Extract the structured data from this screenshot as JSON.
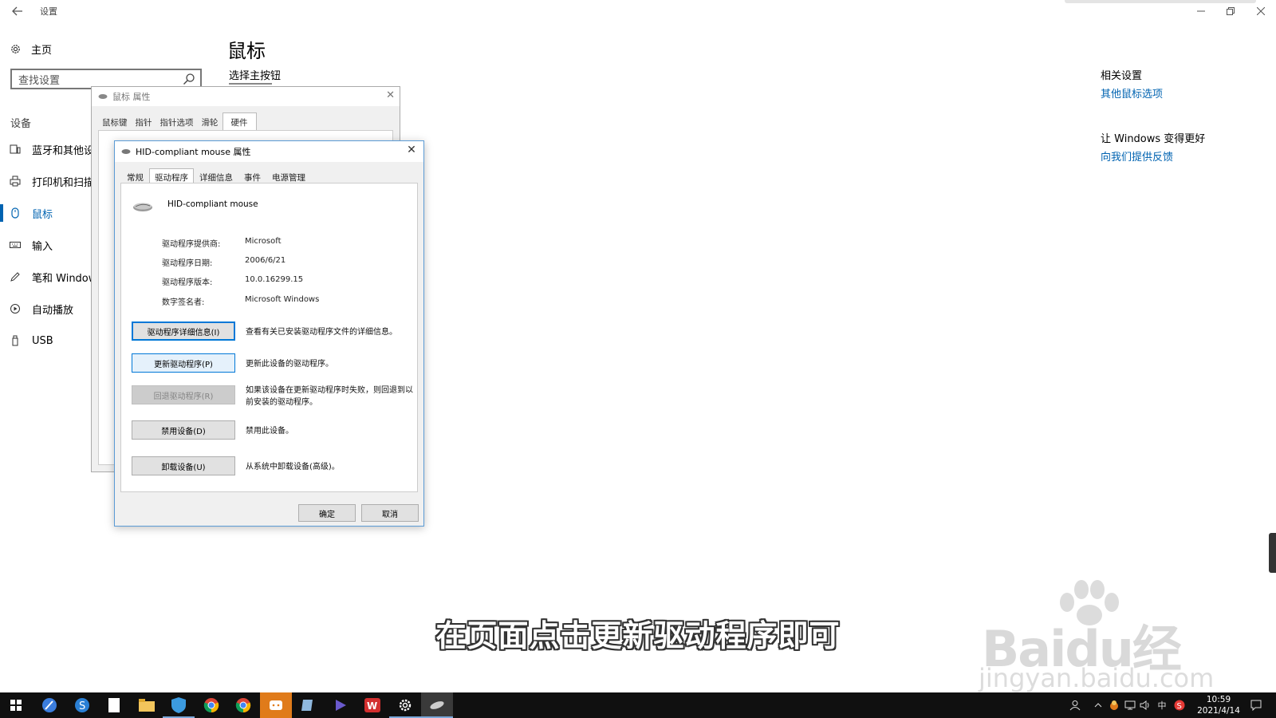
{
  "settings": {
    "app_title": "设置",
    "home_label": "主页",
    "search_placeholder": "查找设置",
    "group_label": "设备",
    "nav_items": [
      {
        "label": "蓝牙和其他设",
        "icon": "bluetooth-devices-icon"
      },
      {
        "label": "打印机和扫描",
        "icon": "printer-icon"
      },
      {
        "label": "鼠标",
        "icon": "mouse-icon"
      },
      {
        "label": "输入",
        "icon": "keyboard-icon"
      },
      {
        "label": "笔和 Window",
        "icon": "pen-icon"
      },
      {
        "label": "自动播放",
        "icon": "autoplay-icon"
      },
      {
        "label": "USB",
        "icon": "usb-icon"
      }
    ],
    "page_title": "鼠标",
    "page_subtitle": "选择主按钮",
    "related_title": "相关设置",
    "related_link": "其他鼠标选项",
    "improve_title": "让 Windows 变得更好",
    "improve_link": "向我们提供反馈"
  },
  "mouse_properties": {
    "title": "鼠标 属性",
    "tabs": [
      "鼠标键",
      "指针",
      "指针选项",
      "滑轮",
      "硬件"
    ],
    "selected_tab": "硬件"
  },
  "hid_dialog": {
    "title": "HID-compliant mouse 属性",
    "tabs": [
      "常规",
      "驱动程序",
      "详细信息",
      "事件",
      "电源管理"
    ],
    "selected_tab": "驱动程序",
    "device_name": "HID-compliant mouse",
    "info": [
      {
        "key": "驱动程序提供商:",
        "value": "Microsoft"
      },
      {
        "key": "驱动程序日期:",
        "value": "2006/6/21"
      },
      {
        "key": "驱动程序版本:",
        "value": "10.0.16299.15"
      },
      {
        "key": "数字签名者:",
        "value": "Microsoft Windows"
      }
    ],
    "actions": [
      {
        "label": "驱动程序详细信息(I)",
        "desc": "查看有关已安装驱动程序文件的详细信息。"
      },
      {
        "label": "更新驱动程序(P)",
        "desc": "更新此设备的驱动程序。"
      },
      {
        "label": "回退驱动程序(R)",
        "desc": "如果该设备在更新驱动程序时失败，则回退到以前安装的驱动程序。"
      },
      {
        "label": "禁用设备(D)",
        "desc": "禁用此设备。"
      },
      {
        "label": "卸载设备(U)",
        "desc": "从系统中卸载设备(高级)。"
      }
    ],
    "ok_label": "确定",
    "cancel_label": "取消"
  },
  "caption": "在页面点击更新驱动程序即可",
  "watermark": {
    "brand": "Baidu经验",
    "sub": "jingyan.baidu.com"
  },
  "taskbar": {
    "time": "10:59",
    "date": "2021/4/14",
    "ime": "中",
    "accent": "#0078d7"
  }
}
